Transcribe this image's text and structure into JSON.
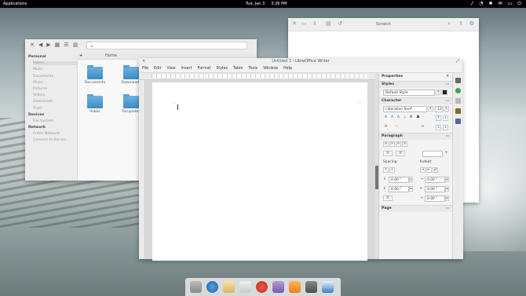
{
  "topbar": {
    "applications": "Applications",
    "date": "Tue, Jan 3",
    "time": "3:26 PM"
  },
  "files": {
    "path_placeholder": "",
    "tab_title": "Home",
    "sidebar": {
      "personal_header": "Personal",
      "personal": [
        "Home",
        "Music",
        "Documents",
        "Music",
        "Pictures",
        "Videos",
        "Downloads",
        "Trash"
      ],
      "devices_header": "Devices",
      "devices": [
        "File System"
      ],
      "network_header": "Network",
      "network": [
        "Entire Network",
        "Connect to Server..."
      ]
    },
    "folders": [
      "Documents",
      "Downloads",
      "Public",
      "Templates"
    ]
  },
  "scratch": {
    "title": "Scratch"
  },
  "writer": {
    "title": "Untitled 1 - LibreOffice Writer",
    "menu": [
      "File",
      "Edit",
      "View",
      "Insert",
      "Format",
      "Styles",
      "Table",
      "Tools",
      "Window",
      "Help"
    ],
    "properties": {
      "header": "Properties",
      "styles_header": "Styles",
      "style_value": "Default Style",
      "character_header": "Character",
      "font_value": "Liberation Serif",
      "size_value": "12",
      "paragraph_header": "Paragraph",
      "spacing_label": "Spacing:",
      "indent_label": "Indent:",
      "spacing_values": [
        "0.00 \"",
        "0.00 \""
      ],
      "indent_values": [
        "0.00 \"",
        "0.00 \"",
        "0.00 \""
      ],
      "page_header": "Page"
    }
  },
  "colors": {
    "accent": "#3a7dc6",
    "folder": "#4a9ad4"
  },
  "dock": {
    "icons": [
      "files-icon",
      "browser-icon",
      "mail-icon",
      "text-editor-icon",
      "tomato-icon",
      "podcast-icon",
      "music-icon",
      "gimp-icon",
      "writer-icon"
    ]
  }
}
